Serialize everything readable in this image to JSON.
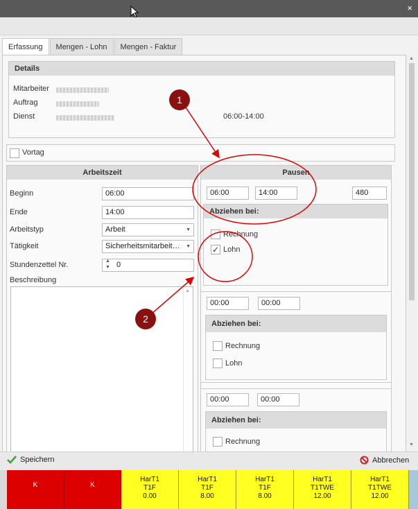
{
  "window": {
    "close_label": "×"
  },
  "tabs": [
    "Erfassung",
    "Mengen - Lohn",
    "Mengen - Faktur"
  ],
  "details": {
    "header": "Details",
    "fields": [
      {
        "label": "Mitarbeiter"
      },
      {
        "label": "Auftrag"
      },
      {
        "label": "Dienst",
        "value": "06:00-14:00"
      }
    ]
  },
  "vortag": {
    "label": "Vortag",
    "checked": false
  },
  "arbeitszeit": {
    "header": "Arbeitszeit",
    "beginn": {
      "label": "Beginn",
      "value": "06:00"
    },
    "ende": {
      "label": "Ende",
      "value": "14:00"
    },
    "arbeitstyp": {
      "label": "Arbeitstyp",
      "value": "Arbeit"
    },
    "taetigkeit": {
      "label": "Tätigkeit",
      "value": "Sicherheitsmitarbeit…"
    },
    "stundenzettel": {
      "label": "Stundenzettel Nr.",
      "value": "0"
    },
    "beschreibung": {
      "label": "Beschreibung"
    }
  },
  "pausen": {
    "header": "Pausen",
    "blocks": [
      {
        "from": "06:00",
        "to": "14:00",
        "minutes": "480",
        "abziehen_label": "Abziehen bei:",
        "rechnung": {
          "label": "Rechnung",
          "checked": false
        },
        "lohn": {
          "label": "Lohn",
          "checked": true
        }
      },
      {
        "from": "00:00",
        "to": "00:00",
        "abziehen_label": "Abziehen bei:",
        "rechnung": {
          "label": "Rechnung",
          "checked": false
        },
        "lohn": {
          "label": "Lohn",
          "checked": false
        }
      },
      {
        "from": "00:00",
        "to": "00:00",
        "abziehen_label": "Abziehen bei:",
        "rechnung": {
          "label": "Rechnung",
          "checked": false
        }
      }
    ]
  },
  "annotations": [
    "1",
    "2"
  ],
  "buttons": {
    "save": "Speichern",
    "cancel": "Abbrechen"
  },
  "colors": {
    "red": "#dd0000",
    "yellow": "#ffff22",
    "annotation": "#e00000"
  },
  "footer_cells": [
    {
      "color": "red",
      "lines": [
        "K"
      ]
    },
    {
      "color": "red",
      "lines": [
        "K"
      ]
    },
    {
      "color": "yellow",
      "lines": [
        "HarT1",
        "T1F",
        "0.00"
      ]
    },
    {
      "color": "yellow",
      "lines": [
        "HarT1",
        "T1F",
        "8.00"
      ]
    },
    {
      "color": "yellow",
      "lines": [
        "HarT1",
        "T1F",
        "8.00"
      ]
    },
    {
      "color": "yellow",
      "lines": [
        "HarT1",
        "T1TWE",
        "12.00"
      ]
    },
    {
      "color": "yellow",
      "lines": [
        "HarT1",
        "T1TWE",
        "12.00"
      ]
    }
  ]
}
